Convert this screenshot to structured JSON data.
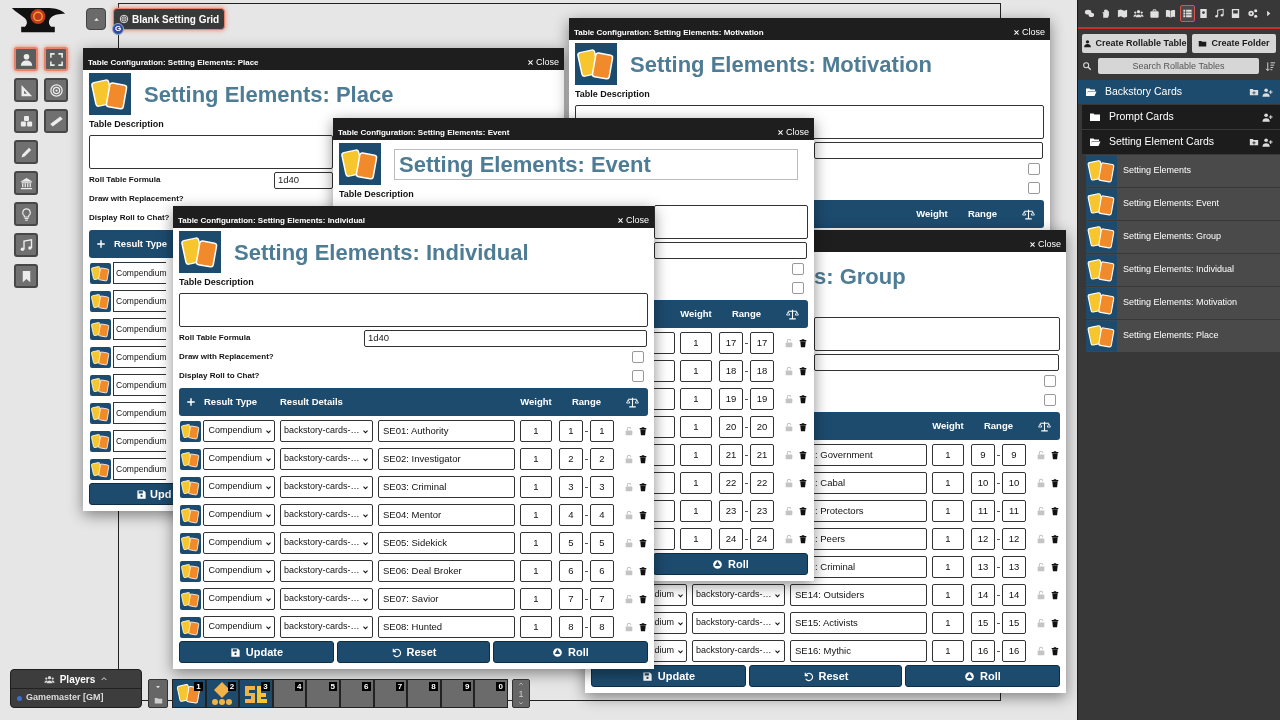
{
  "scene": {
    "label": "Blank Setting Grid",
    "active": true,
    "marker": "G"
  },
  "tools": [
    {
      "kind": "person",
      "selected": true
    },
    {
      "kind": "fullscreen",
      "selected": true
    },
    {
      "kind": "ruler-angle",
      "selected": false
    },
    {
      "kind": "target",
      "selected": false
    },
    {
      "kind": "cubes",
      "selected": false
    },
    {
      "kind": "ruler",
      "selected": false
    },
    {
      "kind": "pencil",
      "selected": false
    },
    {
      "kind": "bank",
      "selected": false
    },
    {
      "kind": "lightbulb",
      "selected": false
    },
    {
      "kind": "music",
      "selected": false
    },
    {
      "kind": "bookmark",
      "selected": false
    }
  ],
  "windows": [
    {
      "title": "Table Configuration: Setting Elements: Place",
      "close": "Close",
      "heading": "Setting Elements: Place",
      "heading_editing": false,
      "description_label": "Table Description",
      "formula_label": "Roll Table Formula",
      "formula": "1d40",
      "replacement_label": "Draw with Replacement?",
      "chat_label": "Display Roll to Chat?",
      "columns": {
        "result_type": "Result Type"
      },
      "rows": [
        {
          "type": "Compendium"
        },
        {
          "type": "Compendium"
        },
        {
          "type": "Compendium"
        },
        {
          "type": "Compendium"
        },
        {
          "type": "Compendium"
        },
        {
          "type": "Compendium"
        },
        {
          "type": "Compendium"
        },
        {
          "type": "Compendium"
        }
      ],
      "buttons": [
        {
          "kind": "update",
          "label": "Upd"
        }
      ]
    },
    {
      "title": "Table Configuration: Setting Elements: Motivation",
      "close": "Close",
      "heading": "Setting Elements: Motivation",
      "heading_editing": false,
      "description_label": "Table Description",
      "replacement_checked": false,
      "chat_checked": false,
      "columns": {
        "weight": "Weight",
        "range": "Range"
      }
    },
    {
      "close": "Close",
      "heading": "s: Group",
      "heading_editing": false,
      "replacement_checked": false,
      "chat_checked": false,
      "columns": {
        "weight": "Weight",
        "range": "Range"
      },
      "rows": [
        {
          "text": ": Government",
          "weight": "1",
          "from": "9",
          "to": "9"
        },
        {
          "text": ": Cabal",
          "weight": "1",
          "from": "10",
          "to": "10"
        },
        {
          "text": ": Protectors",
          "weight": "1",
          "from": "11",
          "to": "11"
        },
        {
          "text": ": Peers",
          "weight": "1",
          "from": "12",
          "to": "12"
        },
        {
          "text": ": Criminal",
          "weight": "1",
          "from": "13",
          "to": "13"
        },
        {
          "type": "dium",
          "details": "backstory-cards-…",
          "text": "SE14: Outsiders",
          "weight": "1",
          "from": "14",
          "to": "14"
        },
        {
          "type": "dium",
          "details": "backstory-cards-…",
          "text": "SE15: Activists",
          "weight": "1",
          "from": "15",
          "to": "15"
        },
        {
          "type": "dium",
          "details": "backstory-cards-…",
          "text": "SE16: Mythic",
          "weight": "1",
          "from": "16",
          "to": "16"
        }
      ],
      "buttons": [
        {
          "kind": "update",
          "label": "Update"
        },
        {
          "kind": "reset",
          "label": "Reset"
        },
        {
          "kind": "roll",
          "label": "Roll"
        }
      ]
    },
    {
      "title": "Table Configuration: Setting Elements: Event",
      "close": "Close",
      "heading": "Setting Elements: Event",
      "heading_editing": true,
      "description_label": "Table Description",
      "replacement_checked": false,
      "chat_checked": false,
      "columns": {
        "weight": "Weight",
        "range": "Range"
      },
      "rows": [
        {
          "weight": "1",
          "from": "17",
          "to": "17"
        },
        {
          "weight": "1",
          "from": "18",
          "to": "18"
        },
        {
          "weight": "1",
          "from": "19",
          "to": "19"
        },
        {
          "weight": "1",
          "from": "20",
          "to": "20"
        },
        {
          "weight": "1",
          "from": "21",
          "to": "21"
        },
        {
          "weight": "1",
          "from": "22",
          "to": "22"
        },
        {
          "weight": "1",
          "from": "23",
          "to": "23"
        },
        {
          "weight": "1",
          "from": "24",
          "to": "24"
        }
      ],
      "buttons": [
        {
          "kind": "roll",
          "label": "Roll"
        }
      ]
    },
    {
      "title": "Table Configuration: Setting Elements: Individual",
      "close": "Close",
      "heading": "Setting Elements: Individual",
      "heading_editing": false,
      "description_label": "Table Description",
      "formula_label": "Roll Table Formula",
      "formula": "1d40",
      "replacement_label": "Draw with Replacement?",
      "replacement_checked": false,
      "chat_label": "Display Roll to Chat?",
      "chat_checked": false,
      "columns": {
        "result_type": "Result Type",
        "result_details": "Result Details",
        "weight": "Weight",
        "range": "Range"
      },
      "rows": [
        {
          "type": "Compendium",
          "details": "backstory-cards-…",
          "text": "SE01: Authority",
          "weight": "1",
          "from": "1",
          "to": "1"
        },
        {
          "type": "Compendium",
          "details": "backstory-cards-…",
          "text": "SE02: Investigator",
          "weight": "1",
          "from": "2",
          "to": "2"
        },
        {
          "type": "Compendium",
          "details": "backstory-cards-…",
          "text": "SE03: Criminal",
          "weight": "1",
          "from": "3",
          "to": "3"
        },
        {
          "type": "Compendium",
          "details": "backstory-cards-…",
          "text": "SE04: Mentor",
          "weight": "1",
          "from": "4",
          "to": "4"
        },
        {
          "type": "Compendium",
          "details": "backstory-cards-…",
          "text": "SE05: Sidekick",
          "weight": "1",
          "from": "5",
          "to": "5"
        },
        {
          "type": "Compendium",
          "details": "backstory-cards-…",
          "text": "SE06: Deal Broker",
          "weight": "1",
          "from": "6",
          "to": "6"
        },
        {
          "type": "Compendium",
          "details": "backstory-cards-…",
          "text": "SE07: Savior",
          "weight": "1",
          "from": "7",
          "to": "7"
        },
        {
          "type": "Compendium",
          "details": "backstory-cards-…",
          "text": "SE08: Hunted",
          "weight": "1",
          "from": "8",
          "to": "8"
        }
      ],
      "buttons": [
        {
          "kind": "update",
          "label": "Update"
        },
        {
          "kind": "reset",
          "label": "Reset"
        },
        {
          "kind": "roll",
          "label": "Roll"
        }
      ]
    }
  ],
  "directory": {
    "tabs": [
      {
        "kind": "chat",
        "selected": false
      },
      {
        "kind": "hand",
        "selected": false
      },
      {
        "kind": "map",
        "selected": false
      },
      {
        "kind": "people",
        "selected": false
      },
      {
        "kind": "bag",
        "selected": false
      },
      {
        "kind": "book",
        "selected": false
      },
      {
        "kind": "list",
        "selected": true
      },
      {
        "kind": "badge",
        "selected": false
      },
      {
        "kind": "music",
        "selected": false
      },
      {
        "kind": "compendium",
        "selected": false
      },
      {
        "kind": "gears",
        "selected": false
      },
      {
        "kind": "more",
        "selected": false
      }
    ],
    "create_table": "Create Rollable Table",
    "create_folder": "Create Folder",
    "search_placeholder": "Search Rollable Tables",
    "tree": [
      {
        "kind": "folder",
        "label": "Backstory Cards",
        "color": "#1d4b6e",
        "expanded": true,
        "children": [
          {
            "kind": "folder",
            "label": "Prompt Cards",
            "color": "#1c1c1c",
            "expanded": false
          },
          {
            "kind": "folder",
            "label": "Setting Element Cards",
            "color": "#1c1c1c",
            "expanded": true,
            "children": [
              {
                "kind": "table",
                "label": "Setting Elements"
              },
              {
                "kind": "table",
                "label": "Setting Elements: Event"
              },
              {
                "kind": "table",
                "label": "Setting Elements: Group"
              },
              {
                "kind": "table",
                "label": "Setting Elements: Individual"
              },
              {
                "kind": "table",
                "label": "Setting Elements: Motivation"
              },
              {
                "kind": "table",
                "label": "Setting Elements: Place"
              }
            ]
          }
        ]
      }
    ]
  },
  "players": {
    "title": "Players",
    "list": [
      {
        "name": "Gamemaster [GM]",
        "color": "#3b6fd6"
      }
    ]
  },
  "hotbar": {
    "slots": [
      {
        "number": "1",
        "kind": "cards"
      },
      {
        "number": "2",
        "kind": "dice"
      },
      {
        "number": "3",
        "kind": "logo"
      },
      {
        "number": "4"
      },
      {
        "number": "5"
      },
      {
        "number": "6"
      },
      {
        "number": "7"
      },
      {
        "number": "8"
      },
      {
        "number": "9"
      },
      {
        "number": "0"
      }
    ],
    "page": "1"
  }
}
